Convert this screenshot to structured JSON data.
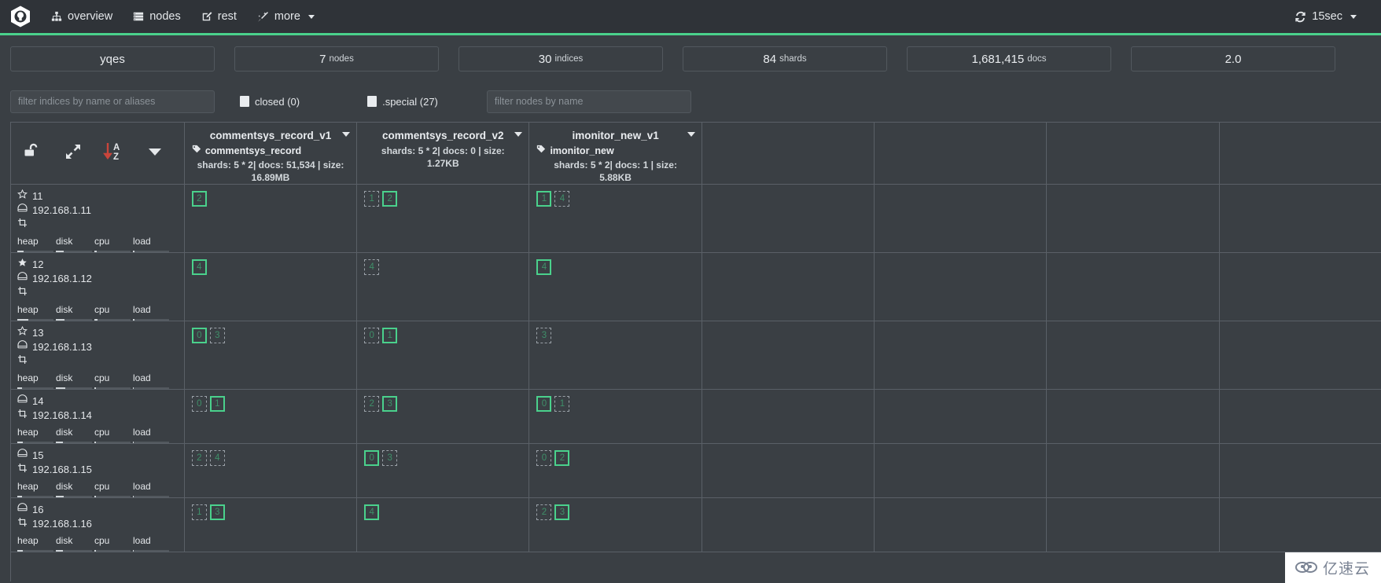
{
  "navbar": {
    "brand_icon": "kopf-logo-icon",
    "items": [
      {
        "label": "overview",
        "icon": "sitemap-icon",
        "active": true
      },
      {
        "label": "nodes",
        "icon": "server-list-icon",
        "active": false
      },
      {
        "label": "rest",
        "icon": "edit-square-icon",
        "active": false
      },
      {
        "label": "more",
        "icon": "magic-wand-icon",
        "active": false,
        "has_caret": true
      }
    ],
    "refresh": {
      "label": "15sec",
      "icon": "refresh-icon",
      "has_caret": true
    }
  },
  "stats": [
    {
      "number": "yqes",
      "unit": "",
      "name": "cluster-name"
    },
    {
      "number": "7",
      "unit": "nodes",
      "name": "nodes-count"
    },
    {
      "number": "30",
      "unit": "indices",
      "name": "indices-count"
    },
    {
      "number": "84",
      "unit": "shards",
      "name": "shards-count"
    },
    {
      "number": "1,681,415",
      "unit": "docs",
      "name": "docs-count"
    },
    {
      "number": "2.0",
      "unit": "",
      "name": "size-stat"
    }
  ],
  "filters": {
    "indices_placeholder": "filter indices by name or aliases",
    "indices_value": "",
    "closed_label": "closed (0)",
    "special_label": ".special (27)",
    "nodes_placeholder": "filter nodes by name",
    "nodes_value": ""
  },
  "toolbar": [
    {
      "icon": "unlock-icon",
      "name": "lock-toggle-button"
    },
    {
      "icon": "expand-arrows-icon",
      "name": "expand-button"
    },
    {
      "icon": "sort-alpha-asc-icon",
      "name": "sort-button"
    },
    {
      "icon": "chevron-down-icon",
      "name": "options-dropdown-button"
    }
  ],
  "indices": [
    {
      "name": "commentsys_record_v1",
      "alias": "commentsys_record",
      "meta": "shards: 5 * 2| docs: 51,534 | size: 16.89MB"
    },
    {
      "name": "commentsys_record_v2",
      "alias": "",
      "meta": "shards: 5 * 2| docs: 0 | size: 1.27KB"
    },
    {
      "name": "imonitor_new_v1",
      "alias": "imonitor_new",
      "meta": "shards: 5 * 2| docs: 1 | size: 5.88KB"
    },
    {
      "name": "",
      "alias": "",
      "meta": ""
    },
    {
      "name": "",
      "alias": "",
      "meta": ""
    },
    {
      "name": "",
      "alias": "",
      "meta": ""
    },
    {
      "name": "",
      "alias": "",
      "meta": ""
    }
  ],
  "nodes": [
    {
      "id": "11",
      "ip": "192.168.1.11",
      "role_icon": "star-outline-icon",
      "has_role_star": true,
      "disk_icon": "server-icon",
      "client_icon": "client-node-icon",
      "client_on_own_line": true,
      "metrics": [
        {
          "label": "heap",
          "pct": 18
        },
        {
          "label": "disk",
          "pct": 22
        },
        {
          "label": "cpu",
          "pct": 6
        },
        {
          "label": "load",
          "pct": 4
        }
      ]
    },
    {
      "id": "12",
      "ip": "192.168.1.12",
      "role_icon": "star-filled-icon",
      "has_role_star": true,
      "disk_icon": "server-icon",
      "client_icon": "client-node-icon",
      "client_on_own_line": true,
      "metrics": [
        {
          "label": "heap",
          "pct": 30
        },
        {
          "label": "disk",
          "pct": 24
        },
        {
          "label": "cpu",
          "pct": 8
        },
        {
          "label": "load",
          "pct": 5
        }
      ]
    },
    {
      "id": "13",
      "ip": "192.168.1.13",
      "role_icon": "star-outline-icon",
      "has_role_star": true,
      "disk_icon": "server-icon",
      "client_icon": "client-node-icon",
      "client_on_own_line": true,
      "metrics": [
        {
          "label": "heap",
          "pct": 12
        },
        {
          "label": "disk",
          "pct": 26
        },
        {
          "label": "cpu",
          "pct": 5
        },
        {
          "label": "load",
          "pct": 3
        }
      ]
    },
    {
      "id": "14",
      "ip": "192.168.1.14",
      "role_icon": "",
      "has_role_star": false,
      "disk_icon": "server-icon",
      "client_icon": "client-node-icon",
      "client_on_own_line": false,
      "metrics": [
        {
          "label": "heap",
          "pct": 16
        },
        {
          "label": "disk",
          "pct": 20
        },
        {
          "label": "cpu",
          "pct": 4
        },
        {
          "label": "load",
          "pct": 3
        }
      ]
    },
    {
      "id": "15",
      "ip": "192.168.1.15",
      "role_icon": "",
      "has_role_star": false,
      "disk_icon": "server-icon",
      "client_icon": "client-node-icon",
      "client_on_own_line": false,
      "metrics": [
        {
          "label": "heap",
          "pct": 14
        },
        {
          "label": "disk",
          "pct": 21
        },
        {
          "label": "cpu",
          "pct": 4
        },
        {
          "label": "load",
          "pct": 3
        }
      ]
    },
    {
      "id": "16",
      "ip": "192.168.1.16",
      "role_icon": "",
      "has_role_star": false,
      "disk_icon": "server-icon",
      "client_icon": "client-node-icon",
      "client_on_own_line": false,
      "metrics": [
        {
          "label": "heap",
          "pct": 15
        },
        {
          "label": "disk",
          "pct": 19
        },
        {
          "label": "cpu",
          "pct": 4
        },
        {
          "label": "load",
          "pct": 3
        }
      ]
    }
  ],
  "shard_matrix": [
    [
      [
        {
          "n": "2",
          "type": "primary"
        }
      ],
      [
        {
          "n": "1",
          "type": "replica"
        },
        {
          "n": "2",
          "type": "primary"
        }
      ],
      [
        {
          "n": "1",
          "type": "primary"
        },
        {
          "n": "4",
          "type": "replica"
        }
      ],
      [],
      [],
      [],
      []
    ],
    [
      [
        {
          "n": "4",
          "type": "primary"
        }
      ],
      [
        {
          "n": "4",
          "type": "replica"
        }
      ],
      [
        {
          "n": "4",
          "type": "primary"
        }
      ],
      [],
      [],
      [],
      []
    ],
    [
      [
        {
          "n": "0",
          "type": "primary"
        },
        {
          "n": "3",
          "type": "replica"
        }
      ],
      [
        {
          "n": "0",
          "type": "replica"
        },
        {
          "n": "1",
          "type": "primary"
        }
      ],
      [
        {
          "n": "3",
          "type": "replica"
        }
      ],
      [],
      [],
      [],
      []
    ],
    [
      [
        {
          "n": "0",
          "type": "replica"
        },
        {
          "n": "1",
          "type": "primary"
        }
      ],
      [
        {
          "n": "2",
          "type": "replica"
        },
        {
          "n": "3",
          "type": "primary"
        }
      ],
      [
        {
          "n": "0",
          "type": "primary"
        },
        {
          "n": "1",
          "type": "replica"
        }
      ],
      [],
      [],
      [],
      []
    ],
    [
      [
        {
          "n": "2",
          "type": "replica"
        },
        {
          "n": "4",
          "type": "replica"
        }
      ],
      [
        {
          "n": "0",
          "type": "primary"
        },
        {
          "n": "3",
          "type": "replica"
        }
      ],
      [
        {
          "n": "0",
          "type": "replica"
        },
        {
          "n": "2",
          "type": "primary"
        }
      ],
      [],
      [],
      [],
      []
    ],
    [
      [
        {
          "n": "1",
          "type": "replica"
        },
        {
          "n": "3",
          "type": "primary"
        }
      ],
      [
        {
          "n": "4",
          "type": "primary"
        }
      ],
      [
        {
          "n": "2",
          "type": "replica"
        },
        {
          "n": "3",
          "type": "primary"
        }
      ],
      [],
      [],
      [],
      []
    ]
  ],
  "watermark": {
    "text": "亿速云",
    "icon": "cloud-icon"
  },
  "colors": {
    "accent_green": "#4ad18c",
    "bg_dark": "#3a3f44",
    "bg_navbar": "#2f3338",
    "border": "#5a6067",
    "text": "#e4e7ea",
    "shard_text": "#3f8f69",
    "replica_border": "#9aa1a8"
  }
}
